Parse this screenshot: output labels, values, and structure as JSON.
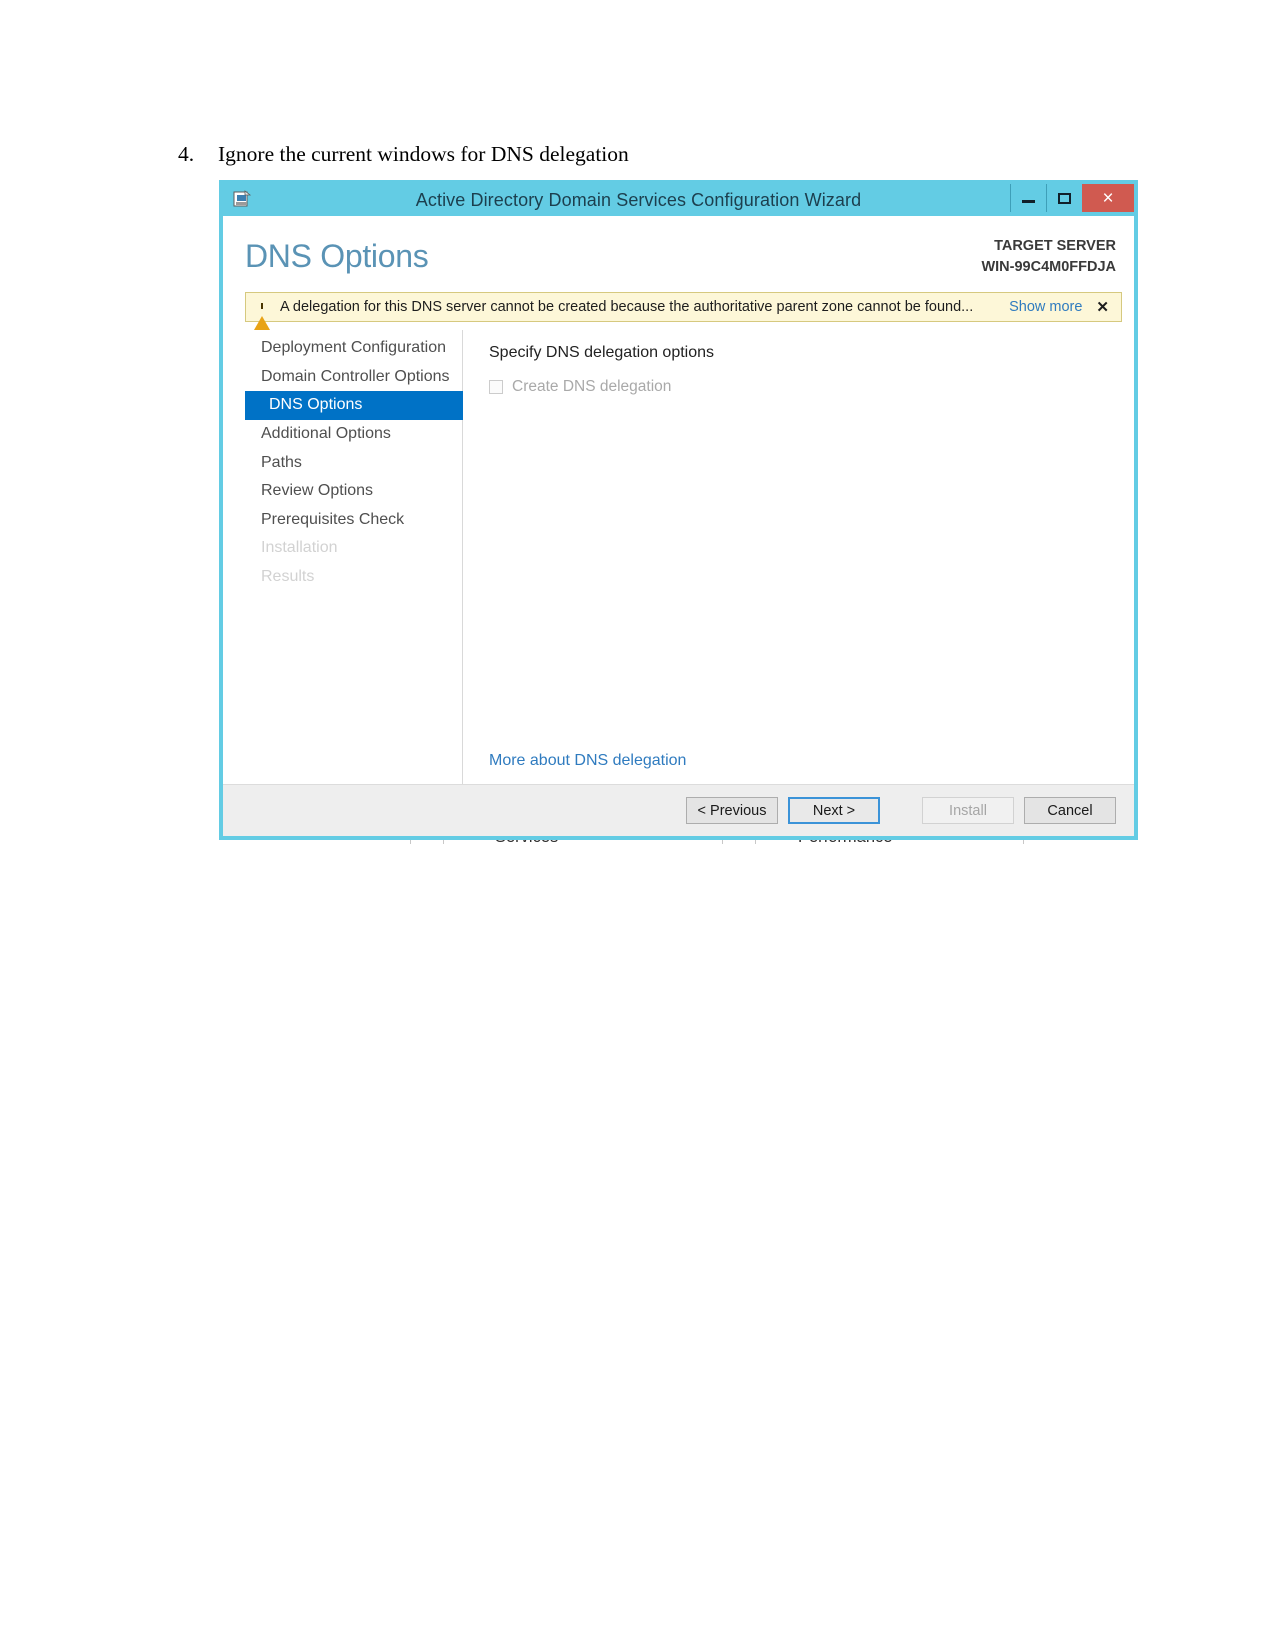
{
  "document": {
    "step_number": "4.",
    "step_text": "Ignore the current windows for DNS delegation"
  },
  "window": {
    "title": "Active Directory Domain Services Configuration Wizard",
    "icon": "wizard-app-icon",
    "controls": {
      "minimize": "–",
      "maximize": "□",
      "close": "×"
    },
    "accent_color": "#63cce4",
    "close_color": "#d05a50"
  },
  "header": {
    "page_title": "DNS Options",
    "target_label": "TARGET SERVER",
    "target_server": "WIN-99C4M0FFDJA"
  },
  "warning": {
    "icon": "warning-triangle-icon",
    "message": "A delegation for this DNS server cannot be created because the authoritative parent zone cannot be found...",
    "show_more": "Show more",
    "close": "✕",
    "background_color": "#fdf7d8",
    "border_color": "#d6c97f"
  },
  "nav": {
    "items": [
      {
        "label": "Deployment Configuration",
        "state": "normal"
      },
      {
        "label": "Domain Controller Options",
        "state": "normal"
      },
      {
        "label": "DNS Options",
        "state": "active"
      },
      {
        "label": "Additional Options",
        "state": "normal"
      },
      {
        "label": "Paths",
        "state": "normal"
      },
      {
        "label": "Review Options",
        "state": "normal"
      },
      {
        "label": "Prerequisites Check",
        "state": "normal"
      },
      {
        "label": "Installation",
        "state": "disabled"
      },
      {
        "label": "Results",
        "state": "disabled"
      }
    ],
    "active_color": "#0072c6"
  },
  "content": {
    "heading": "Specify DNS delegation options",
    "checkbox_label": "Create DNS delegation",
    "checkbox_checked": false,
    "checkbox_enabled": false,
    "more_link": "More about DNS delegation"
  },
  "footer": {
    "previous": "< Previous",
    "next": "Next >",
    "install": "Install",
    "cancel": "Cancel",
    "install_enabled": false,
    "focused_button": "Next >"
  },
  "background": {
    "word_left": "Services",
    "word_right": "Performance"
  }
}
